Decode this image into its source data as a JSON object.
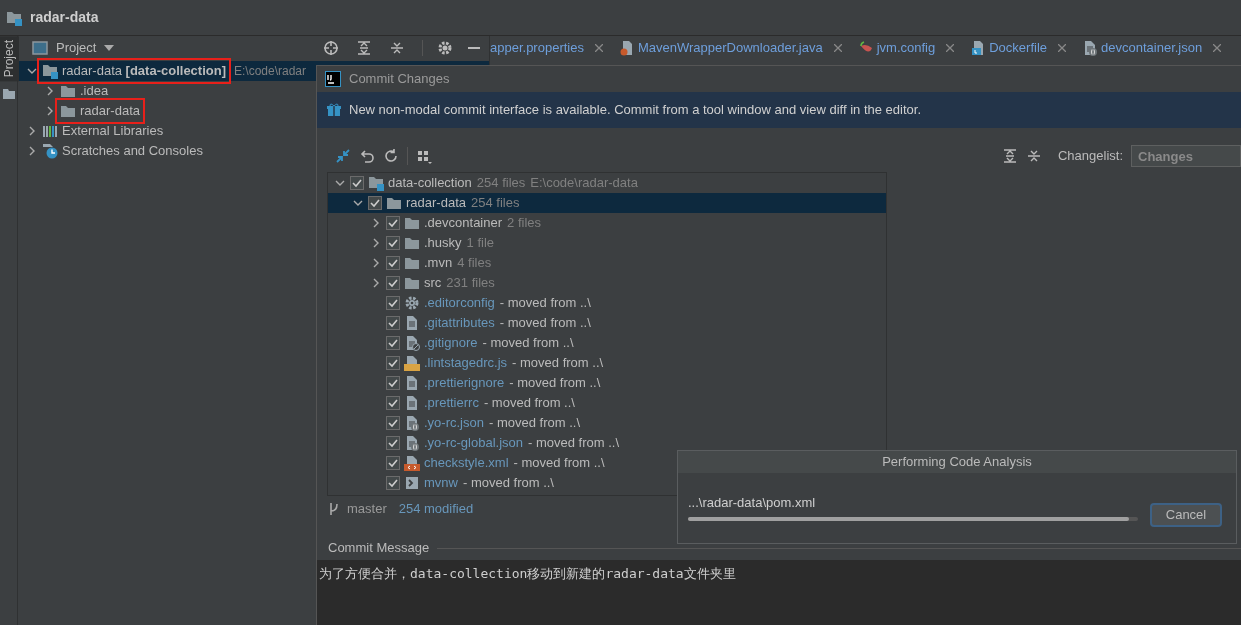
{
  "window": {
    "title": "radar-data"
  },
  "tool_stripe": [
    {
      "label": "Project",
      "selected": true
    }
  ],
  "project_panel": {
    "title": "Project",
    "tree": [
      {
        "kind": "module",
        "label": "radar-data **[data-collection]**",
        "path": "E:\\code\\radar",
        "expanded": true,
        "selected": true,
        "highlighted": true,
        "children": [
          {
            "kind": "folder",
            "label": ".idea",
            "expanded": false,
            "selected": false,
            "highlighted": false
          },
          {
            "kind": "folder",
            "label": "radar-data",
            "expanded": false,
            "selected": false,
            "highlighted": true
          }
        ]
      },
      {
        "kind": "library",
        "label": "External Libraries",
        "expanded": false,
        "selected": false,
        "highlighted": false
      },
      {
        "kind": "scratches",
        "label": "Scratches and Consoles",
        "expanded": false,
        "selected": false,
        "highlighted": false
      }
    ]
  },
  "editor_tabs": [
    {
      "kind": "properties",
      "label": "apper.properties",
      "selected": false
    },
    {
      "kind": "java",
      "label": "MavenWrapperDownloader.java",
      "selected": false
    },
    {
      "kind": "config",
      "label": "jvm.config",
      "selected": false
    },
    {
      "kind": "docker",
      "label": "Dockerfile",
      "selected": false
    },
    {
      "kind": "json",
      "label": "devcontainer.json",
      "selected": false
    }
  ],
  "commit_dialog": {
    "title": "Commit Changes",
    "banner": "New non-modal commit interface is available. Commit from a tool window and view diff in the editor.",
    "changelist_label": "Changelist:",
    "changelist_value": "Changes",
    "tree": [
      {
        "kind": "module",
        "label": "data-collection",
        "detail": "254 files",
        "path": "E:\\code\\radar-data",
        "checked": true,
        "expanded": true,
        "selected": false,
        "children": [
          {
            "kind": "folder",
            "label": "radar-data",
            "detail": "254 files",
            "checked": true,
            "expanded": true,
            "selected": true,
            "children": [
              {
                "kind": "folder",
                "label": ".devcontainer",
                "detail": "2 files",
                "checked": true,
                "expanded": false,
                "selected": false
              },
              {
                "kind": "folder",
                "label": ".husky",
                "detail": "1 file",
                "checked": true,
                "expanded": false,
                "selected": false
              },
              {
                "kind": "folder",
                "label": ".mvn",
                "detail": "4 files",
                "checked": true,
                "expanded": false,
                "selected": false
              },
              {
                "kind": "folder",
                "label": "src",
                "detail": "231 files",
                "checked": true,
                "expanded": false,
                "selected": false
              },
              {
                "kind": "settings",
                "label": ".editorconfig",
                "detail": "- moved from ..\\",
                "checked": true,
                "selected": false
              },
              {
                "kind": "text",
                "label": ".gitattributes",
                "detail": "- moved from ..\\",
                "checked": true,
                "selected": false
              },
              {
                "kind": "ignore",
                "label": ".gitignore",
                "detail": "- moved from ..\\",
                "checked": true,
                "selected": false
              },
              {
                "kind": "js",
                "label": ".lintstagedrc.js",
                "detail": "- moved from ..\\",
                "checked": true,
                "selected": false
              },
              {
                "kind": "text",
                "label": ".prettierignore",
                "detail": "- moved from ..\\",
                "checked": true,
                "selected": false
              },
              {
                "kind": "text",
                "label": ".prettierrc",
                "detail": "- moved from ..\\",
                "checked": true,
                "selected": false
              },
              {
                "kind": "json",
                "label": ".yo-rc.json",
                "detail": "- moved from ..\\",
                "checked": true,
                "selected": false
              },
              {
                "kind": "json",
                "label": ".yo-rc-global.json",
                "detail": "- moved from ..\\",
                "checked": true,
                "selected": false
              },
              {
                "kind": "xml",
                "label": "checkstyle.xml",
                "detail": "- moved from ..\\",
                "checked": true,
                "selected": false
              },
              {
                "kind": "shell",
                "label": "mvnw",
                "detail": "- moved from ..\\",
                "checked": true,
                "selected": false
              }
            ]
          }
        ]
      }
    ],
    "branch": "master",
    "modified": "254 modified",
    "message_label": "Commit Message",
    "message": "为了方便合并，data-collection移动到新建的radar-data文件夹里"
  },
  "progress_popup": {
    "title": "Performing Code Analysis",
    "file": "...\\radar-data\\pom.xml",
    "level": 0.98,
    "button": "Cancel"
  }
}
